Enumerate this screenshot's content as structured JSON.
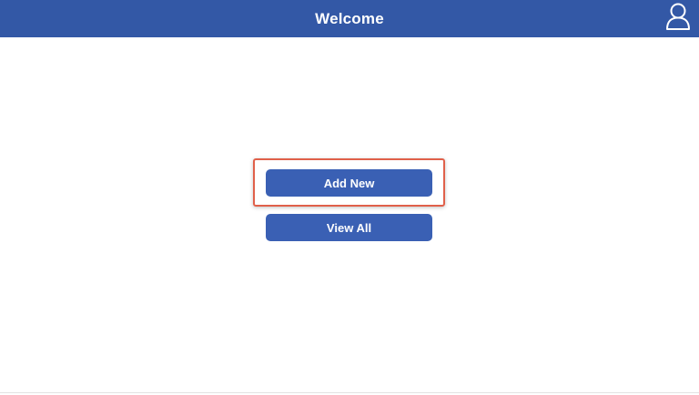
{
  "header": {
    "title": "Welcome",
    "user_icon": "user-icon"
  },
  "actions": {
    "add_new_label": "Add New",
    "view_all_label": "View All"
  },
  "colors": {
    "header_bg": "#3358a6",
    "button_bg": "#3a60b4",
    "highlight_border": "#e0604a"
  }
}
